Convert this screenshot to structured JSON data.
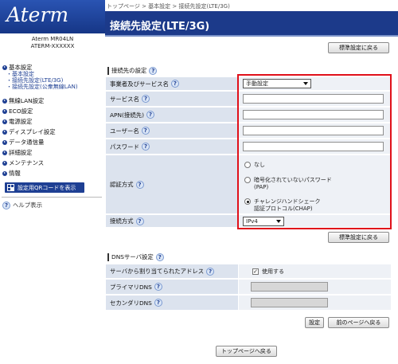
{
  "brand": {
    "logo": "Aterm",
    "model": "Aterm MR04LN",
    "device_id": "ATERM-XXXXXX"
  },
  "sidebar": {
    "items": [
      {
        "type": "major",
        "label": "基本設定"
      },
      {
        "type": "sub",
        "label": "・基本設定"
      },
      {
        "type": "sub",
        "label": "・接続先設定(LTE/3G)"
      },
      {
        "type": "sub",
        "label": "・接続先設定(公衆無線LAN)"
      },
      {
        "type": "major",
        "label": "無線LAN設定"
      },
      {
        "type": "major",
        "label": "ECO設定"
      },
      {
        "type": "major",
        "label": "電源設定"
      },
      {
        "type": "major",
        "label": "ディスプレイ設定"
      },
      {
        "type": "major",
        "label": "データ通信量"
      },
      {
        "type": "major",
        "label": "詳細設定"
      },
      {
        "type": "major",
        "label": "メンテナンス"
      },
      {
        "type": "major",
        "label": "情報"
      }
    ],
    "qr_button": "設定用QRコードを表示",
    "help": "ヘルプ表示"
  },
  "breadcrumb": "トップページ > 基本設定 > 接続先設定(LTE/3G)",
  "page_title": "接続先設定(LTE/3G)",
  "buttons": {
    "restore_top": "標準設定に戻る",
    "restore_mid": "標準設定に戻る",
    "set": "設定",
    "back": "前のページへ戻る",
    "top": "トップページへ戻る"
  },
  "section_connection": {
    "title": "接続先の設定",
    "rows": {
      "provider": {
        "label": "事業者及びサービス名",
        "value": "手動設定"
      },
      "service_name": {
        "label": "サービス名",
        "value": ""
      },
      "apn": {
        "label": "APN(接続先)",
        "value": ""
      },
      "username": {
        "label": "ユーザー名",
        "value": ""
      },
      "password": {
        "label": "パスワード",
        "value": ""
      },
      "auth": {
        "label": "認証方式",
        "options": [
          {
            "line1": "なし",
            "line2": "",
            "checked": false
          },
          {
            "line1": "暗号化されていないパスワード",
            "line2": "(PAP)",
            "checked": false
          },
          {
            "line1": "チャレンジハンドシェーク",
            "line2": "認証プロトコル(CHAP)",
            "checked": true
          }
        ]
      },
      "conn_type": {
        "label": "接続方式",
        "value": "IPv4"
      }
    }
  },
  "section_dns": {
    "title": "DNSサーバ設定",
    "rows": {
      "auto": {
        "label": "サーバから割り当てられたアドレス",
        "checkbox_label": "使用する",
        "checked": true
      },
      "primary": {
        "label": "プライマリDNS",
        "value": ""
      },
      "secondary": {
        "label": "セカンダリDNS",
        "value": ""
      }
    }
  },
  "help_icon_glyph": "?",
  "colors": {
    "brand_blue": "#1c3a8a",
    "highlight_red": "#e0101a",
    "label_bg": "#dce3ee"
  }
}
